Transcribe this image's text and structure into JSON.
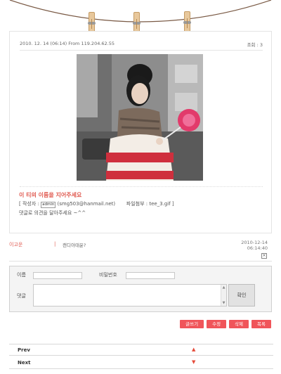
{
  "post": {
    "date_info": "2010. 12. 14 (06:14) From 119.204.62.55",
    "views": "조회 : 3",
    "title": "이 티의 이름을 지어주세요",
    "author_prefix": "[ 작성자 : ",
    "author_badge": "admin",
    "author_email": " (smg503@hanmail.net)",
    "attachment": "파일첨부 : tee_3.gif ]",
    "body": "댓글로 의견을 달아주세요 ~^^"
  },
  "comment": {
    "author": "이고운",
    "separator": "|",
    "text": "캔디아태윤?",
    "date": "2010-12-14",
    "time": "06:14:40",
    "delete_glyph": "×"
  },
  "form": {
    "name_label": "이름",
    "password_label": "비밀번호",
    "comment_label": "댓글",
    "scroll_up": "▲",
    "scroll_down": "▼",
    "confirm_label": "확인"
  },
  "buttons": {
    "write": "글쓰기",
    "edit": "수정",
    "delete": "삭제",
    "list": "목록"
  },
  "nav": {
    "prev_label": "Prev",
    "prev_arrow": "▲",
    "next_label": "Next",
    "next_arrow": "▼"
  },
  "colors": {
    "accent": "#f0555a",
    "title_red": "#e05a50",
    "pin": "#e8c89c"
  }
}
